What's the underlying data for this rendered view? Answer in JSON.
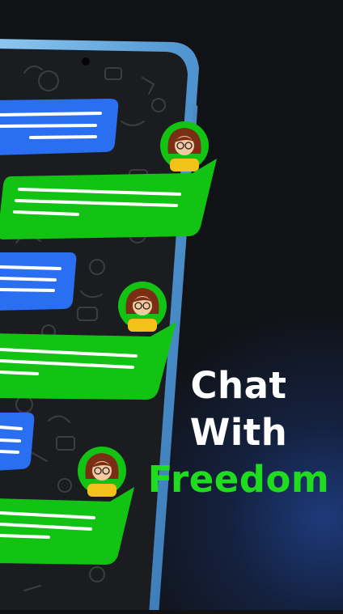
{
  "headline": {
    "line1": "Chat",
    "line2": "With",
    "line3": "Freedom"
  },
  "colors": {
    "background": "#111216",
    "accent_green": "#1fdc1f",
    "bubble_green": "#13c313",
    "bubble_blue": "#2a6ff2",
    "phone_frame": "#6fb4e8"
  },
  "icons": {
    "avatar": "woman-with-glasses-avatar",
    "wallpaper": "doodle-pattern"
  }
}
